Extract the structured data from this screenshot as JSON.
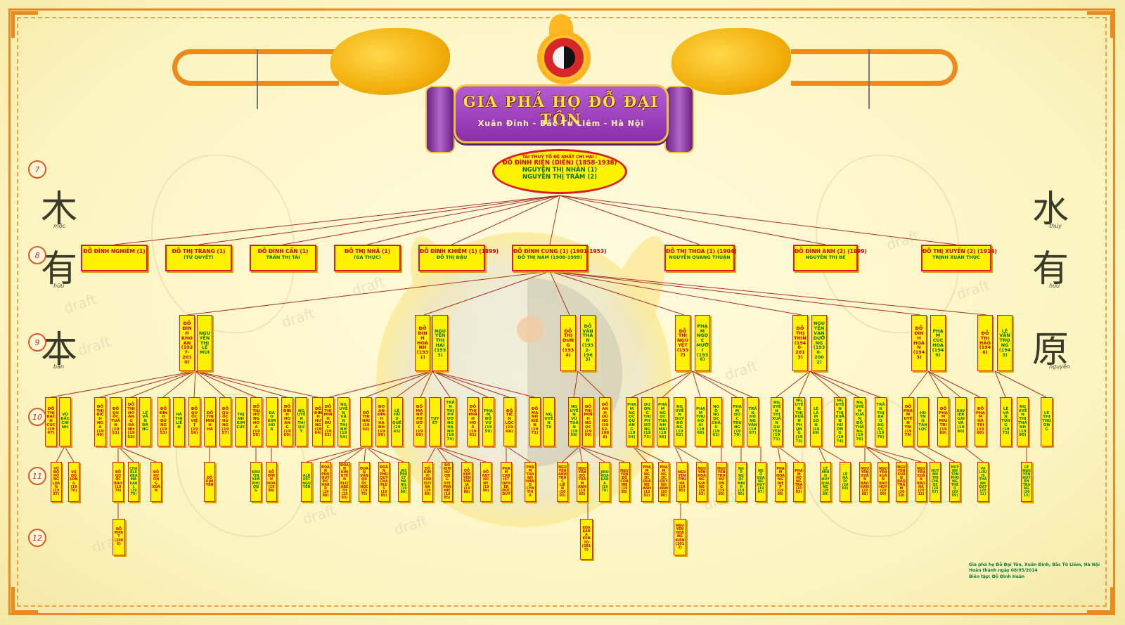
{
  "header": {
    "title": "GIA PHẢ HỌ ĐỖ ĐẠI TÔN",
    "subtitle": "Xuân Đỉnh - Bắc Từ Liêm - Hà Nội"
  },
  "generations": [
    "7",
    "8",
    "9",
    "10",
    "11",
    "12"
  ],
  "calligraphy": {
    "left": [
      {
        "char": "木",
        "sub": "mộc"
      },
      {
        "char": "有",
        "sub": "hữu"
      },
      {
        "char": "本",
        "sub": "bản"
      }
    ],
    "right": [
      {
        "char": "水",
        "sub": "thủy"
      },
      {
        "char": "有",
        "sub": "hữu"
      },
      {
        "char": "原",
        "sub": "nguyên"
      }
    ]
  },
  "watermark": "draft",
  "root": {
    "caption": "TÀI THUỶ TỔ ĐỆ NHẤT CHI HAI :",
    "name": "ĐỖ ĐÌNH RIÊN (DIÊN) (1858-1938)",
    "spouse1": "NGUYỄN THỊ NHÃN (1)",
    "spouse2": "NGUYỄN THỊ TRÂM (2)"
  },
  "gen8": [
    {
      "a": "ĐỖ ĐÌNH NGHIÊM (1)",
      "b": ""
    },
    {
      "a": "ĐỖ THỊ TRANG (1)",
      "b": "(TỬ QUYẾT)"
    },
    {
      "a": "ĐỖ ĐÌNH CẨN (1)",
      "b": "TRẦN THỊ TÀI"
    },
    {
      "a": "ĐỖ THỊ NHÃ (1)",
      "b": "(GA THỤC)"
    },
    {
      "a": "ĐỖ ĐÌNH KHIÊM (1) (1899)",
      "b": "ĐỖ THỊ ĐẬU"
    },
    {
      "a": "ĐỖ ĐÌNH CUNG (1) (1901-1953)",
      "b": "ĐỖ THỊ NĂM (1908-1999)"
    },
    {
      "a": "ĐỖ THỊ THOA (1) (1904)",
      "b": "NGUYỄN QUANG THUẬN"
    },
    {
      "a": "ĐỖ ĐÌNH ANH (2) (1899)",
      "b": "NGUYỄN THỊ BÉ"
    },
    {
      "a": "ĐỖ THỊ XUYẾN (2) (1914)",
      "b": "TRỊNH XUÂN THỤC"
    }
  ],
  "gen9": [
    "ĐỖ ĐÌNH KHOAN (1927-2010)",
    "NGUYỄN THỊ LÊ MÙI",
    "ĐỖ ĐÌNH HOÀNH (1931)",
    "NGUYỄN THỊ HAI (1933)",
    "ĐỖ THỊ DUNG (1934)",
    "ĐỖ VĂN THÂN (1932-1963)",
    "ĐỖ THỊ NGUYỆT (1937)",
    "PHẠM NGỌC MƯỜI (1936)",
    "ĐỖ THỊ THÌN (1940-2013)",
    "NGUYỄN VĂN DƯỠNG (1930-2002)",
    "ĐỖ ĐÌNH HOÀN (1943)",
    "PHẠM CÚC HOA (1949)",
    "ĐỖ THỊ HẢO (1946)",
    "LÊ VĂN TRỌNG (1943)"
  ],
  "gen10": [
    "ĐỖ THỊ BẠCH CÚC (1947)",
    "VŨ BẮC CHÍNH",
    "ĐỖ THỊ BÍCH NGA (1949)",
    "ĐỖ QUỐC TUẤN (1951)",
    "ĐỖ THỊ HOÀNG OANH (1953)",
    "LÊ VĂN ĐĂNG",
    "ĐỖ ĐÌNH DŨNG (1953)",
    "HÀ THỊ LIÊN",
    "ĐỖ QUỐC VIỆT (1956)",
    "ĐỖ THỊ MINH HÀ",
    "ĐỖ QUỐC HÙNG (1957)",
    "TRỊNH KIM CÚC",
    "ĐỖ THỊ HỒNG HOA (1959)",
    "ĐÀO KIM HOA",
    "ĐỖ ĐÌNH HOÀNG (1960)",
    "NGUYỄN THỊ QUÝ",
    "ĐỖ ĐÌNH HƯNG (1964)",
    "ĐỖ THỊ MINH ĐỨC (1952)",
    "NGUYỄN VĂN THỊNH (1954)",
    "ĐỖ THỊ HẢI (1956)",
    "ĐOÀN ĐÌNH HẠNH (1956)",
    "LÊ HỮU QUẾ (1945)",
    "ĐỖ MẠNH PHƯỚC (1960)",
    "TUYẾT",
    "TRẦN THỊ PHƯƠNG HẠNH (1974)",
    "ĐỖ THỊ MINH HOÀ (1961)",
    "PHẠM ĐỖ VŨ (1959)",
    "ĐỖ TIẾN LỘC (1968)",
    "ĐỖ MẠNH KIÊN (1971)",
    "NGUYỄN TÚ",
    "NGUYỄN VŨ TUẤN (1958)",
    "ĐỖ THỊ MINH NGỌC (1959)",
    "ĐỖ ANH DŨNG (1962-1988)",
    "PHẠM NGỌC QUANG (1964)",
    "DƯƠNG THỊ PHƯƠNG (1975)",
    "PHẠM NGỌC THANH MAI (1966)",
    "NGUYỄN DUY ĐỒNG (1962)",
    "PHẠM THU HOÀI (1968)",
    "NGÔ NGỌC CHÂU (1962)",
    "PHẠM ĐỨC TRUNG (1970)",
    "TRẦN HỒNG VÂN (1967)",
    "NGUYỄN THỊ XUÂN QUYÊN (1971)",
    "NGUYỄN THỊ XUÂN PHỤNG (1973)",
    "LÊ LAM SƠN (1969)",
    "NGUYỄN THỊ XUÂN HƯƠNG (1974)",
    "NGUYỄN XUÂN ĐỖ THẮNG (1976)",
    "TRẦN THỊ BẢO NGỌC (1976)",
    "ĐỖ PHẠM UYÊN TRI (1979)",
    "HUỲNH TẤN LỘC",
    "ĐỖ PHẠM MAI TRI (1980)",
    "XAVIER GAI VA (1980)",
    "ĐỖ PHẠM HÀ TRI (1980)",
    "LÊ VĂN TÙNG (1973)",
    "NGUYỄN THỊ THANH (1990)",
    "LÊ THỊ THƯƠNG"
  ],
  "gen11": [
    "VŨ ĐỖ HỒNG LOAN (1987)",
    "VŨ ĐỖ LONG (1976)",
    "ĐỖ QUỐC BẢO (1974)",
    "CHARLEARA MAKARL (1975)",
    "ĐỖ HƯƠNG XUÂN",
    "ĐỖ KIM YẾN",
    "ĐÀO THỊ KIM PHƯỢNG",
    "ĐỖ ĐÌNH HOÀ (1984)",
    "ALBERT NGUYỄN",
    "ĐOÀN PHÚ QUÝ RICHARD (1980)",
    "ĐOÀN KIM UYÊN ELIZABETH (1983)",
    "ĐOÀN VĂN QUỐC HỌC (1975)",
    "ĐOÀN PHÚ QUÝ CHARLES (1985)",
    "JASPREET MAHIL (1986)",
    "ĐỖ KIM VI CHRISTINA (1984)",
    "ĐỖ KIM HƯƠNG STEPHANIE (1985)",
    "ĐỖ KIM YẾN TANIA (1988)",
    "ĐỖ ANTHONY (1990)",
    "PHẠM CHRISTOPHER ĐỨC DUY",
    "PHẠM THANH HẰNG CYNTHIA",
    "NGUYỄN ANH TRÚC LIÊN (2003)",
    "NGUYỄN ĐỖ TRÂM ANH (1983)",
    "JIRO KOAKARA (1979)",
    "NGUYỄN ĐỖ CORINE (1985)",
    "PHẠM NGỌC QUANG ANH (1992)",
    "PHẠM NGỌC QUỲNH ANH (2000)",
    "NGUYỄN THU HÀ (1985)",
    "NGUYỄN HOÀNG GIANG (1993)",
    "NGUYỄN THU HƯƠNG (1993)",
    "NGÔ NGỌC MINH (1995)",
    "NGÔ QUANG HUY (1997)",
    "PHẠM HOÀNG DIỆP (1996)",
    "PHẠM HỒNG TRÀ (2003)",
    "LÊ MINH HUY QUANG (2000)",
    "LÊ HÀ DI (2004)",
    "NGUYỄN XUÂN BẢO HÂN (2008)",
    "NGUYỄN XUÂN BẢO HUY (2009)",
    "NGUYỄN XUÂN BẢO TRÂM (2010)",
    "NGUYỄN XUÂN BẢO HÀ (2012)",
    "HUỲNH TRI CHLOE (2007)",
    "HUỲNH TẤN PHONG THÉO (2009)",
    "VA LOUIS THÀNH ĐẠT (2011)",
    "LÊ NGUYỄN HUYỀN TRANG (2013)"
  ],
  "gen12": [
    "ĐỖ PIPAT (2006)",
    "KOAKARA KENTO (2010)",
    "NGUYỄN HOÀNG KIÊN (2012)"
  ],
  "note": [
    "Gia phả họ Đỗ Đại Tôn, Xuân Đỉnh, Bắc Từ Liêm, Hà Nội",
    "Hoàn thành ngày 08/05/2014",
    "Biên tập: Đỗ Đình Hoàn"
  ],
  "colors": {
    "accent": "#ec8a1c",
    "box": "#fff200",
    "border": "#d91e1e",
    "male": "#cc0000",
    "spouse": "#0a6e2a",
    "line": "#a93226"
  }
}
